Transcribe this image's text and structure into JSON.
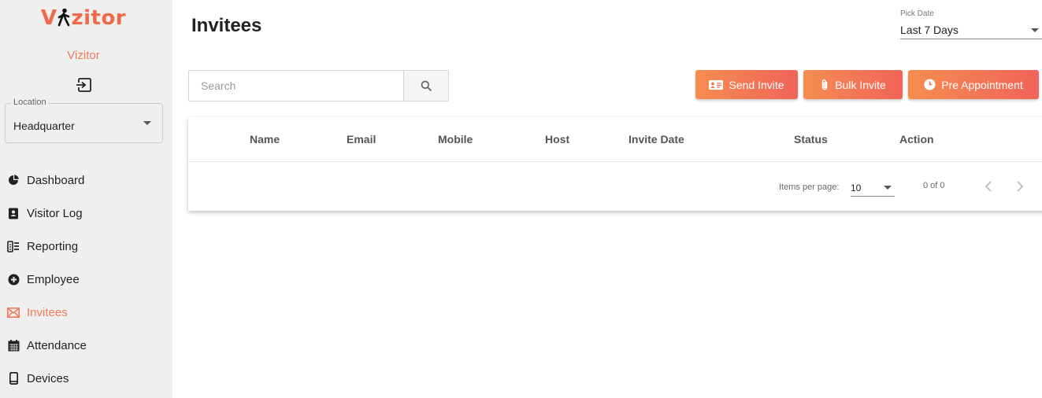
{
  "brand": {
    "logo_prefix": "V",
    "logo_suffix": "zitor",
    "org_name": "Vizitor",
    "accent": "#f06a4a"
  },
  "location": {
    "label": "Location",
    "value": "Headquarter"
  },
  "nav": [
    {
      "label": "Dashboard",
      "icon": "pie-chart-icon"
    },
    {
      "label": "Visitor Log",
      "icon": "contact-book-icon"
    },
    {
      "label": "Reporting",
      "icon": "report-icon"
    },
    {
      "label": "Employee",
      "icon": "plus-circle-icon"
    },
    {
      "label": "Invitees",
      "icon": "envelope-icon",
      "active": true
    },
    {
      "label": "Attendance",
      "icon": "calendar-icon"
    },
    {
      "label": "Devices",
      "icon": "mobile-device-icon"
    }
  ],
  "page": {
    "title": "Invitees"
  },
  "date_filter": {
    "label": "Pick Date",
    "value": "Last 7 Days"
  },
  "search": {
    "placeholder": "Search"
  },
  "actions": {
    "send_invite": "Send Invite",
    "bulk_invite": "Bulk Invite",
    "pre_appointment": "Pre Appointment"
  },
  "table": {
    "columns": [
      "Name",
      "Email",
      "Mobile",
      "Host",
      "Invite Date",
      "Status",
      "Action"
    ],
    "rows": []
  },
  "paginator": {
    "items_per_page_label": "Items per page:",
    "page_size": "10",
    "range": "0 of 0"
  }
}
